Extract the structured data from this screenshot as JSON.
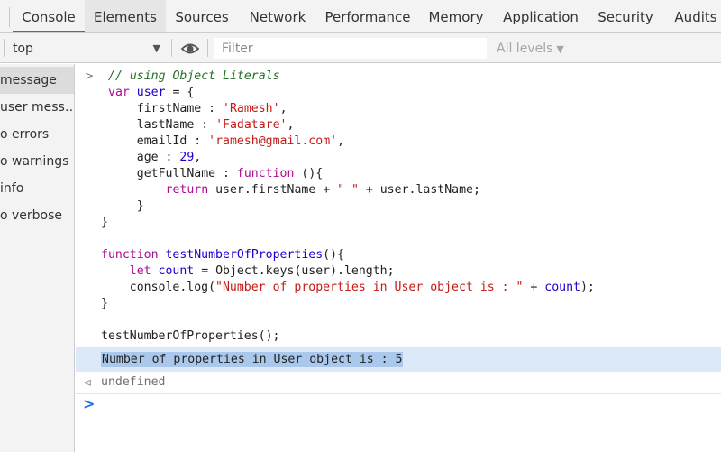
{
  "tabs": [
    {
      "label": "Console",
      "active": true
    },
    {
      "label": "Elements",
      "active": false
    },
    {
      "label": "Sources",
      "active": false
    },
    {
      "label": "Network",
      "active": false
    },
    {
      "label": "Performance",
      "active": false
    },
    {
      "label": "Memory",
      "active": false
    },
    {
      "label": "Application",
      "active": false
    },
    {
      "label": "Security",
      "active": false
    },
    {
      "label": "Audits",
      "active": false
    }
  ],
  "toolbar": {
    "context": "top",
    "filter_placeholder": "Filter",
    "levels_label": "All levels",
    "eye_icon": "eye-icon"
  },
  "sidebar": {
    "items": [
      {
        "label": "message",
        "selected": true
      },
      {
        "label": "user mess…",
        "selected": false
      },
      {
        "label": "o errors",
        "selected": false
      },
      {
        "label": "o warnings",
        "selected": false
      },
      {
        "label": "info",
        "selected": false
      },
      {
        "label": "o verbose",
        "selected": false
      }
    ]
  },
  "console": {
    "input_lines": [
      "// using Object Literals",
      "var user = {",
      "    firstName : 'Ramesh',",
      "    lastName : 'Fadatare',",
      "    emailId : 'ramesh@gmail.com',",
      "    age : 29,",
      "    getFullName : function (){",
      "        return user.firstName + \" \" + user.lastName;",
      "    }",
      "}",
      "",
      "function testNumberOfProperties(){",
      "    let count = Object.keys(user).length;",
      "    console.log(\"Number of properties in User object is : \" + count);",
      "}",
      "",
      "testNumberOfProperties();"
    ],
    "log_output": "Number of properties in User object is : 5",
    "return_value": "undefined"
  },
  "colors": {
    "accent": "#1a73e8",
    "keyword": "#aa0d91",
    "string": "#c41a16",
    "comment": "#236e25",
    "selection": "#a9c8eb"
  }
}
